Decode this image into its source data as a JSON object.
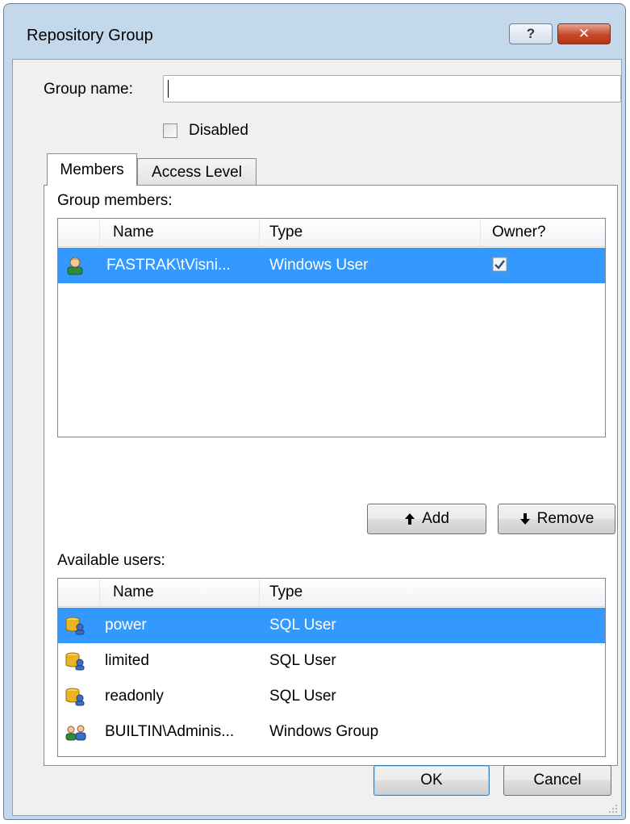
{
  "window": {
    "title": "Repository Group",
    "help_label": "?",
    "close_label": "✕"
  },
  "form": {
    "group_name_label": "Group name:",
    "group_name_value": "",
    "disabled_label": "Disabled",
    "disabled_checked": false
  },
  "tabs": [
    {
      "label": "Members",
      "active": true
    },
    {
      "label": "Access Level",
      "active": false
    }
  ],
  "members": {
    "section_label": "Group members:",
    "columns": [
      "Name",
      "Type",
      "Owner?"
    ],
    "rows": [
      {
        "icon": "windows-user-icon",
        "name": "FASTRAK\\tVisni...",
        "type": "Windows User",
        "owner": true,
        "selected": true
      }
    ]
  },
  "actions": {
    "add_label": "Add",
    "remove_label": "Remove"
  },
  "available": {
    "section_label": "Available users:",
    "columns": [
      "Name",
      "Type"
    ],
    "rows": [
      {
        "icon": "sql-user-icon",
        "name": "power",
        "type": "SQL User",
        "selected": true
      },
      {
        "icon": "sql-user-icon",
        "name": "limited",
        "type": "SQL User",
        "selected": false
      },
      {
        "icon": "sql-user-icon",
        "name": "readonly",
        "type": "SQL User",
        "selected": false
      },
      {
        "icon": "windows-group-icon",
        "name": "BUILTIN\\Adminis...",
        "type": "Windows Group",
        "selected": false
      }
    ]
  },
  "footer": {
    "ok_label": "OK",
    "cancel_label": "Cancel"
  },
  "colors": {
    "selection": "#3399ff",
    "titlebar": "#c4d8ec",
    "close": "#c7472b"
  }
}
